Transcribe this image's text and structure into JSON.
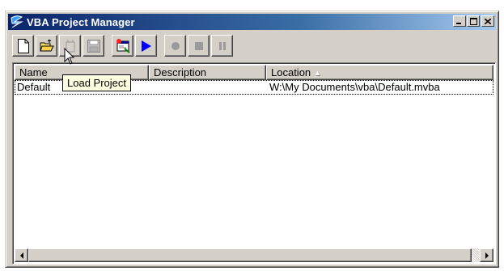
{
  "window": {
    "title": "VBA Project Manager",
    "icon": "vba-logo-icon",
    "controls": [
      "minimize-icon",
      "maximize-icon",
      "close-icon"
    ]
  },
  "toolbar": {
    "buttons": [
      {
        "icon": "new-project-icon",
        "enabled": true
      },
      {
        "icon": "load-project-icon",
        "enabled": true
      },
      {
        "icon": "unload-project-icon",
        "enabled": false
      },
      {
        "icon": "save-project-icon",
        "enabled": false
      },
      {
        "icon": "vba-editor-icon",
        "enabled": true
      },
      {
        "icon": "run-macro-icon",
        "enabled": true
      },
      {
        "icon": "record-icon",
        "enabled": false
      },
      {
        "icon": "stop-icon",
        "enabled": false
      },
      {
        "icon": "pause-icon",
        "enabled": false
      }
    ]
  },
  "tooltip": "Load Project",
  "list": {
    "columns": [
      "Name",
      "Description",
      "Location"
    ],
    "sorted_column": "Location",
    "rows": [
      {
        "name": "Default",
        "description": "",
        "location": "W:\\My Documents\\vba\\Default.mvba"
      }
    ]
  },
  "colors": {
    "title_start": "#0a246a",
    "title_end": "#a6caf0",
    "face": "#d4d0c8",
    "tooltip_bg": "#ffffe1",
    "run_blue": "#0000ff"
  }
}
